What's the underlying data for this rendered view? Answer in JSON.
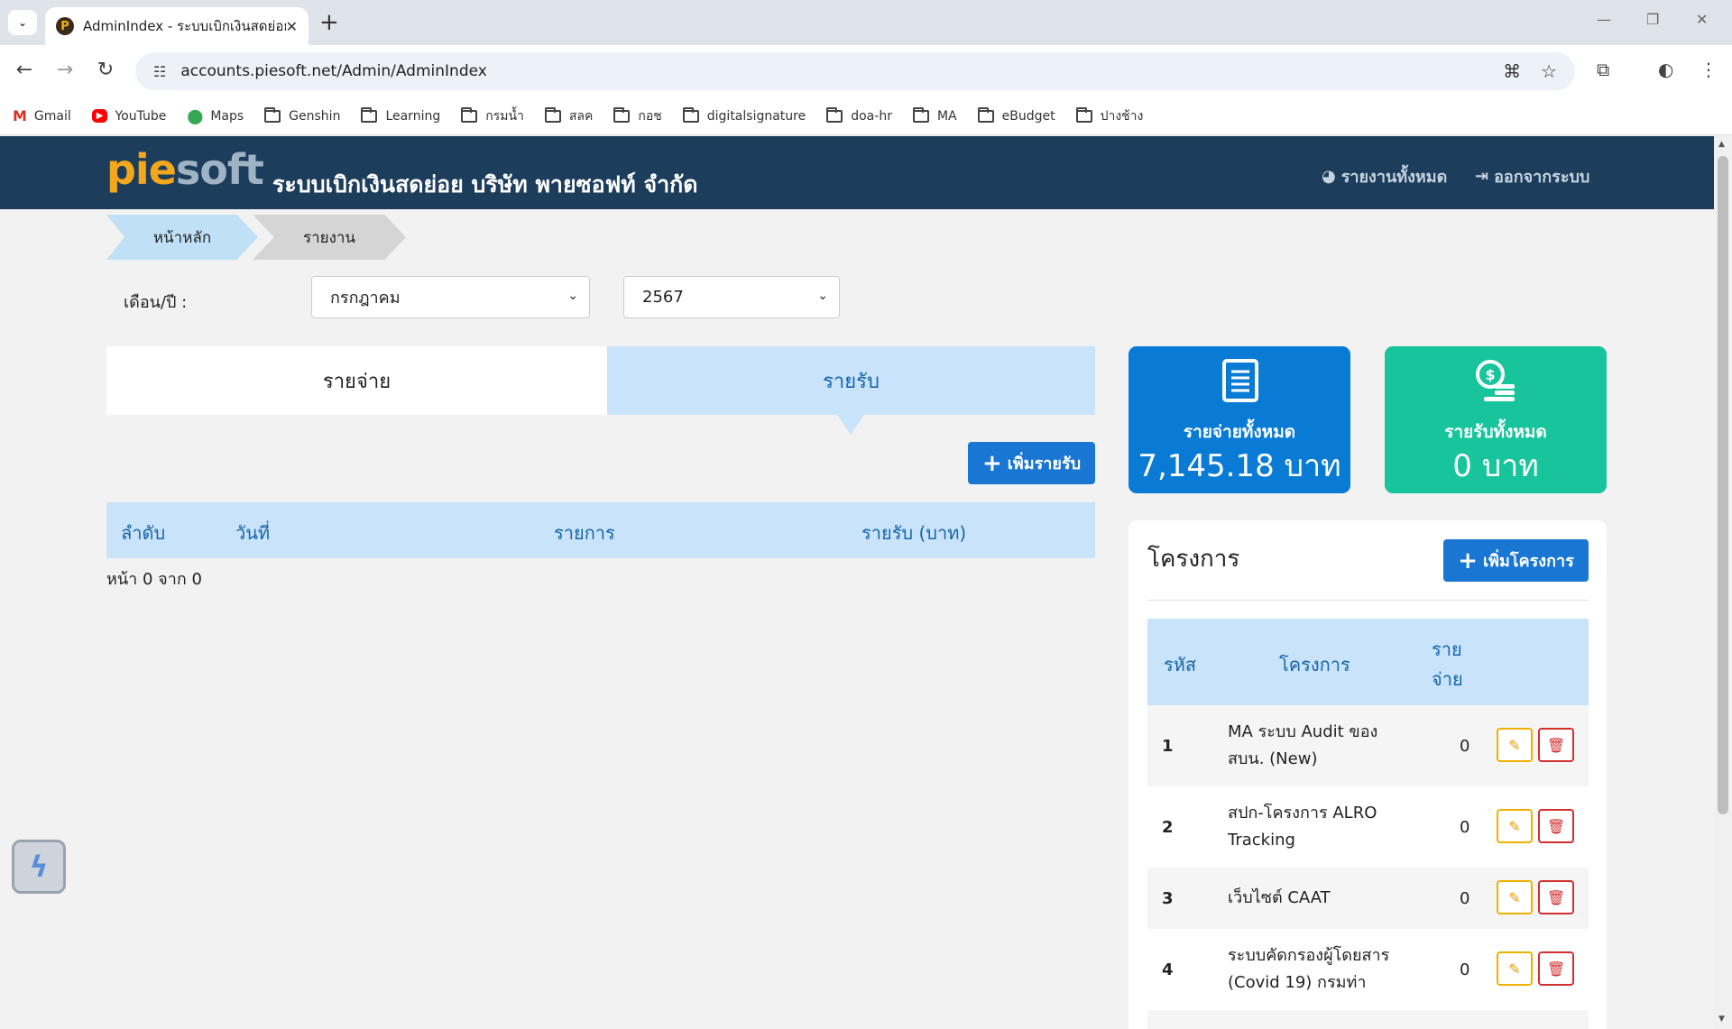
{
  "browser": {
    "tab_title": "AdminIndex - ระบบเบิกเงินสดย่อย",
    "favicon_letter": "P",
    "url": "accounts.piesoft.net/Admin/AdminIndex",
    "bookmarks": [
      {
        "label": "Gmail",
        "icon": "gmail-icon"
      },
      {
        "label": "YouTube",
        "icon": "youtube-icon"
      },
      {
        "label": "Maps",
        "icon": "maps-icon"
      },
      {
        "label": "Genshin",
        "icon": "folder-icon"
      },
      {
        "label": "Learning",
        "icon": "folder-icon"
      },
      {
        "label": "กรมน้ำ",
        "icon": "folder-icon"
      },
      {
        "label": "สลค",
        "icon": "folder-icon"
      },
      {
        "label": "กอช",
        "icon": "folder-icon"
      },
      {
        "label": "digitalsignature",
        "icon": "folder-icon"
      },
      {
        "label": "doa-hr",
        "icon": "folder-icon"
      },
      {
        "label": "MA",
        "icon": "folder-icon"
      },
      {
        "label": "eBudget",
        "icon": "folder-icon"
      },
      {
        "label": "ปางช้าง",
        "icon": "folder-icon"
      }
    ]
  },
  "header": {
    "logo_part1": "pie",
    "logo_part2": "soft",
    "title": "ระบบเบิกเงินสดย่อย บริษัท พายซอฟท์ จำกัด",
    "report_link": "รายงานทั้งหมด",
    "logout_link": "ออกจากระบบ"
  },
  "breadcrumb": {
    "home": "หน้าหลัก",
    "report": "รายงาน"
  },
  "filter": {
    "label": "เดือน/ปี :",
    "month": "กรกฎาคม",
    "year": "2567"
  },
  "tabs": {
    "expense": "รายจ่าย",
    "income": "รายรับ"
  },
  "income": {
    "add_button": "เพิ่มรายรับ",
    "columns": [
      "ลำดับ",
      "วันที่",
      "รายการ",
      "รายรับ (บาท)"
    ],
    "pager": "หน้า 0 จาก 0"
  },
  "stats": {
    "expense_label": "รายจ่ายทั้งหมด",
    "expense_value": "7,145.18 บาท",
    "income_label": "รายรับทั้งหมด",
    "income_value": "0 บาท"
  },
  "projects": {
    "title": "โครงการ",
    "add_button": "เพิ่มโครงการ",
    "columns": {
      "id": "รหัส",
      "name": "โครงการ",
      "amount_line1": "ราย",
      "amount_line2": "จ่าย"
    },
    "rows": [
      {
        "id": "1",
        "name_line1": "MA ระบบ Audit ของ",
        "name_line2": "สบน. (New)",
        "amount": "0"
      },
      {
        "id": "2",
        "name_line1": "สปก-โครงการ ALRO",
        "name_line2": "Tracking",
        "amount": "0"
      },
      {
        "id": "3",
        "name_line1": "เว็บไซต์ CAAT",
        "name_line2": "",
        "amount": "0"
      },
      {
        "id": "4",
        "name_line1": "ระบบคัดกรองผู้โดยสาร",
        "name_line2": "(Covid 19) กรมท่า",
        "amount": "0"
      }
    ]
  },
  "colors": {
    "header_bg": "#1d3d5c",
    "primary": "#1976d2",
    "income_green": "#17c49c",
    "tab_active_bg": "#c9e3fa"
  }
}
